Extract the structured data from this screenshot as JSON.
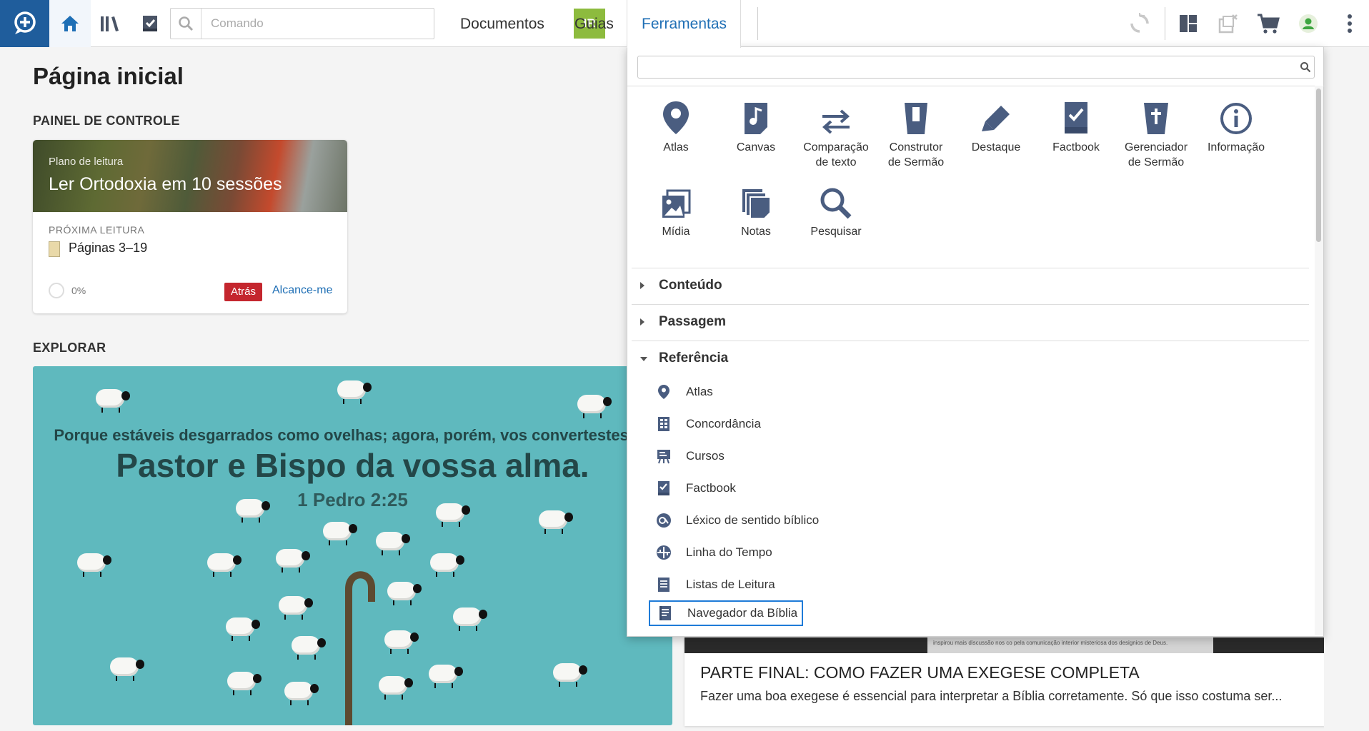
{
  "topbar": {
    "command_placeholder": "Comando",
    "go_label": "IR",
    "nav": [
      "Documentos",
      "Guias",
      "Ferramentas"
    ],
    "active_nav": "Ferramentas"
  },
  "page": {
    "title": "Página inicial",
    "dashboard_label": "PAINEL DE CONTROLE",
    "explore_label": "EXPLORAR"
  },
  "reading_plan": {
    "kicker": "Plano de leitura",
    "title": "Ler Ortodoxia em 10 sessões",
    "next_label": "PRÓXIMA LEITURA",
    "next_value": "Páginas 3–19",
    "progress": "0%",
    "status_badge": "Atrás",
    "catch_up": "Alcance-me"
  },
  "explore_image": {
    "line1": "Porque estáveis desgarrados como ovelhas; agora, porém, vos convertestes ao",
    "line2": "Pastor e Bispo da vossa alma.",
    "line3": "1 Pedro 2:25"
  },
  "article": {
    "scan_text": "inspirou mais discussão nos co   pela comunicação interior misteriosa dos designios de Deus.",
    "title": "PARTE FINAL: COMO FAZER UMA EXEGESE COMPLETA",
    "description": "Fazer uma boa exegese é essencial para interpretar a Bíblia corretamente. Só que isso costuma ser..."
  },
  "tools_panel": {
    "search_value": "",
    "tools_row1": [
      {
        "label": "Atlas",
        "icon": "map-pin-icon"
      },
      {
        "label": "Canvas",
        "icon": "canvas-icon"
      },
      {
        "label": "Comparação de texto",
        "icon": "compare-arrows-icon"
      },
      {
        "label": "Construtor de Sermão",
        "icon": "sermon-builder-icon"
      },
      {
        "label": "Destaque",
        "icon": "highlighter-icon"
      },
      {
        "label": "Factbook",
        "icon": "factbook-icon"
      },
      {
        "label": "Gerenciador de Sermão",
        "icon": "sermon-manager-icon"
      },
      {
        "label": "Informação",
        "icon": "info-icon"
      }
    ],
    "tools_row2": [
      {
        "label": "Mídia",
        "icon": "media-icon"
      },
      {
        "label": "Notas",
        "icon": "notes-icon"
      },
      {
        "label": "Pesquisar",
        "icon": "search-icon"
      }
    ],
    "sections": [
      "Conteúdo",
      "Passagem",
      "Referência"
    ],
    "reference_items": [
      {
        "label": "Atlas",
        "icon": "map-pin-icon"
      },
      {
        "label": "Concordância",
        "icon": "concordance-icon"
      },
      {
        "label": "Cursos",
        "icon": "courses-icon"
      },
      {
        "label": "Factbook",
        "icon": "factbook-icon"
      },
      {
        "label": "Léxico de sentido bíblico",
        "icon": "lexicon-icon"
      },
      {
        "label": "Linha do Tempo",
        "icon": "timeline-icon"
      },
      {
        "label": "Listas de Leitura",
        "icon": "reading-list-icon"
      },
      {
        "label": "Navegador da Bíblia",
        "icon": "bible-browser-icon"
      }
    ],
    "selected_reference": "Navegador da Bíblia"
  },
  "colors": {
    "accent": "#1f6fb5",
    "brand": "#1f5d9c",
    "go": "#8dbb3e",
    "icon": "#4a5d80",
    "badge": "#c4262e"
  }
}
